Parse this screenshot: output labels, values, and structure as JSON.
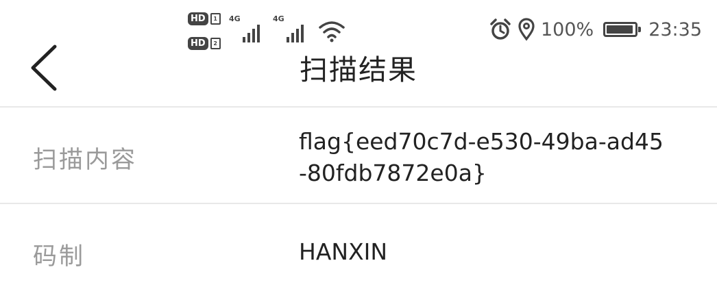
{
  "status_bar": {
    "sim1_badge": "HD",
    "sim1_slot": "1",
    "sim2_badge": "HD",
    "sim2_slot": "2",
    "sim1_network": "4G",
    "sim2_network": "4G",
    "battery_percent": "100%",
    "battery_level": 0.95,
    "time": "23:35",
    "icons": [
      "alarm-icon",
      "location-icon",
      "wifi-icon",
      "battery-icon"
    ]
  },
  "toolbar": {
    "back_icon": "chevron-left-icon",
    "title": "扫描结果"
  },
  "rows": [
    {
      "label": "扫描内容",
      "value_line1": "flag{eed70c7d-e530-49ba-ad45",
      "value_line2": "-80fdb7872e0a}"
    },
    {
      "label": "码制",
      "value": "HANXIN"
    }
  ],
  "colors": {
    "background": "#ffffff",
    "label": "#9a9a9a",
    "value": "#222222",
    "divider": "#e8e8e8",
    "icon": "#444444"
  }
}
